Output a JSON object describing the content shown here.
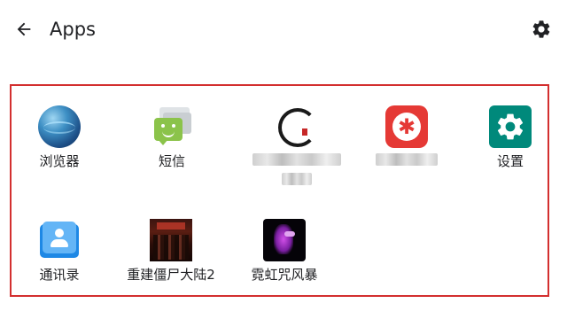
{
  "header": {
    "title": "Apps",
    "back_icon": "arrow-back-icon",
    "settings_icon": "gear-icon"
  },
  "colors": {
    "selection_border": "#d32f2f",
    "settings_app_bg": "#00897b",
    "bug_app_bg": "#e53935",
    "sms_green": "#8bc34a",
    "contacts_blue": "#1e88e5"
  },
  "apps": [
    {
      "label": "浏览器",
      "icon": "globe-icon"
    },
    {
      "label": "短信",
      "icon": "sms-icon"
    },
    {
      "label": "",
      "icon": "ink-logo-icon",
      "label_obscured": true
    },
    {
      "label": "",
      "icon": "red-bug-icon",
      "label_obscured": true
    },
    {
      "label": "设置",
      "icon": "gear-icon"
    },
    {
      "label": "通讯录",
      "icon": "contacts-icon"
    },
    {
      "label": "重建僵尸大陆2",
      "icon": "zombie-game-icon"
    },
    {
      "label": "霓虹咒风暴",
      "icon": "neon-game-icon"
    }
  ]
}
